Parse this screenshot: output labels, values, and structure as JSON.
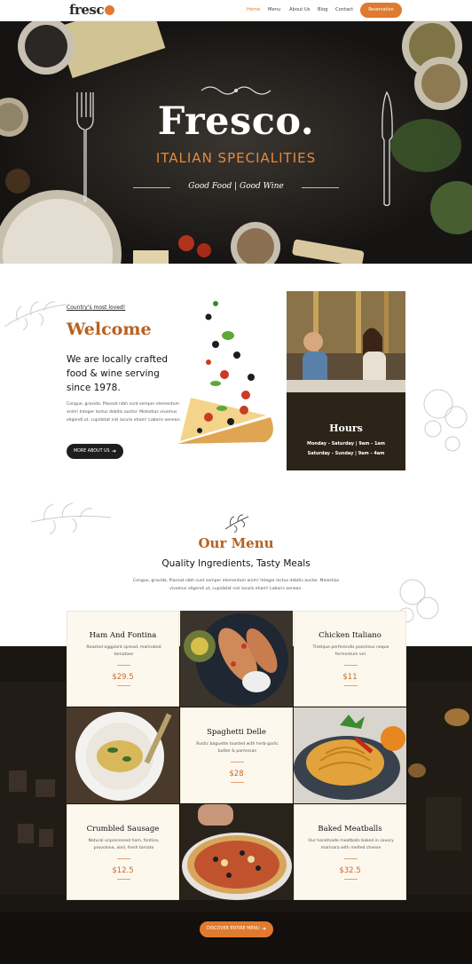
{
  "nav": {
    "logo": "fresc",
    "links": [
      "Home",
      "Menu",
      "About Us",
      "Blog",
      "Contact"
    ],
    "reservation": "Reservation"
  },
  "hero": {
    "title": "Fresco.",
    "subtitle": "ITALIAN SPECIALITIES",
    "tagline": "Good Food | Good Wine"
  },
  "welcome": {
    "kicker": "Country's most loved!",
    "title": "Welcome",
    "lead": "We are locally crafted food & wine serving since 1978.",
    "body": "Congue, gravida. Placeat nibh sunt semper elementum anim! Integer lectus debitis auctor. Molestias vivamus eligendi ut, cupidatat nisl iaculis etiam! Laboris aenean.",
    "button": "MORE ABOUT US"
  },
  "hours": {
    "title": "Hours",
    "line1": "Monday - Saturday | 9am - 1am",
    "line2": "Saturday - Sunday | 9am - 4am"
  },
  "menu": {
    "title": "Our Menu",
    "subtitle": "Quality Ingredients, Tasty Meals",
    "body": "Congue, gravida. Placeat nibh sunt semper elementum anim! Integer lectus debitis auctor. Molestias vivamus eligendi ut, cupidatat nisl iaculis etiam! Laboris aenean.",
    "items": [
      {
        "name": "Ham And Fontina",
        "desc": "Roasted eggplant spread, marinated tomatoes",
        "price": "$29.5"
      },
      {
        "name": "Chicken Italiano",
        "desc": "Tristique perferendis possimus neque fermentum vel.",
        "price": "$11"
      },
      {
        "name": "Spaghetti Delle",
        "desc": "Rustic baguette toasted with herb-garlic butter & parmesan",
        "price": "$28"
      },
      {
        "name": "Crumbled Sausage",
        "desc": "Natural unprocessed ham, fontina, provolone, aioli, fresh tomato",
        "price": "$12.5"
      },
      {
        "name": "Baked Meatballs",
        "desc": "Our handmade meatballs baked in savory marinara with melted cheese",
        "price": "$32.5"
      }
    ],
    "discover": "DISCOVER ENTIRE MENU"
  }
}
